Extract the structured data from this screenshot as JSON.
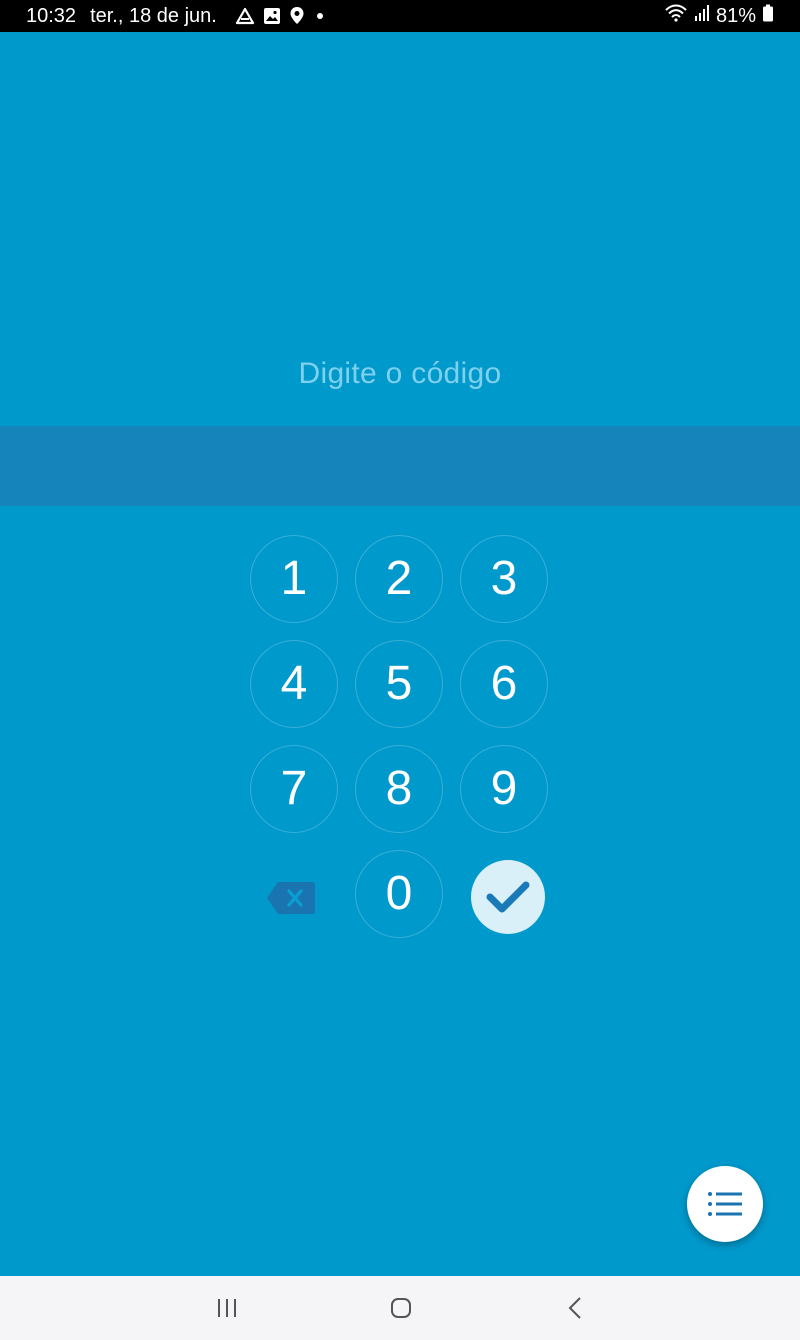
{
  "status_bar": {
    "time": "10:32",
    "date": "ter., 18 de jun.",
    "notification_icons": [
      "drive-icon",
      "gallery-icon",
      "location-icon",
      "dot-icon"
    ],
    "battery": "81%",
    "system_icons": [
      "wifi-icon",
      "signal-icon",
      "battery-icon"
    ]
  },
  "prompt": "Digite o código",
  "code_value": "",
  "keypad": {
    "keys": [
      "1",
      "2",
      "3",
      "4",
      "5",
      "6",
      "7",
      "8",
      "9",
      "0"
    ],
    "backspace_icon": "backspace-icon",
    "confirm_icon": "check-icon"
  },
  "fab_icon": "list-icon",
  "nav_bar": [
    "recents-icon",
    "home-icon",
    "back-icon"
  ],
  "colors": {
    "background": "#0099cc",
    "code_field": "#1584ba",
    "prompt_text": "#7fd0ec",
    "confirm_bg": "#d9f0f8",
    "accent_dark": "#1a74b0"
  }
}
